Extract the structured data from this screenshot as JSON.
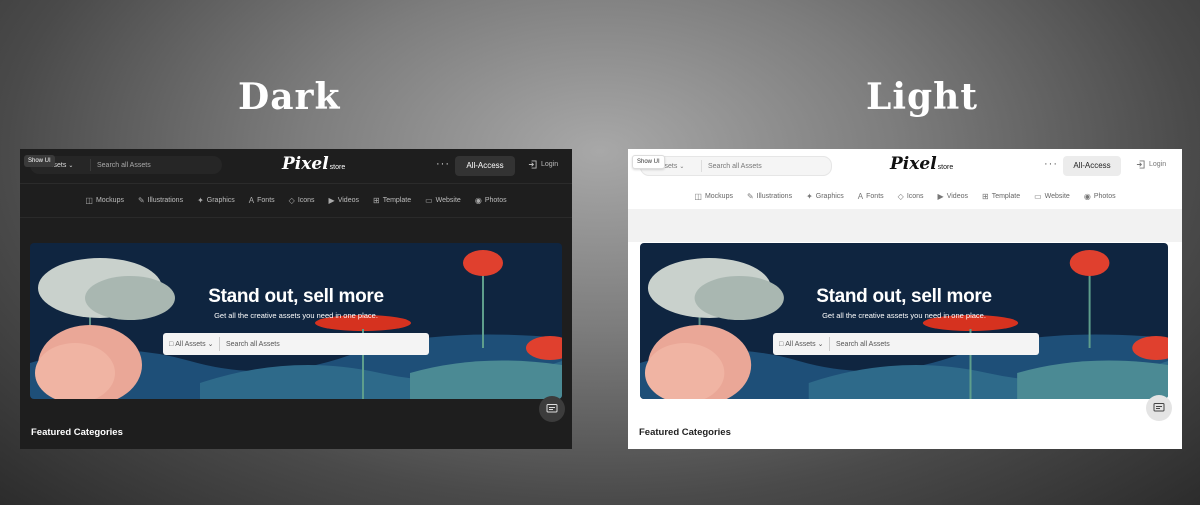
{
  "headings": {
    "dark": "Dark",
    "light": "Light"
  },
  "app": {
    "show_ui": "Show UI",
    "search_category": "All Assets",
    "search_placeholder": "Search all Assets",
    "logo_main": "Pixel",
    "logo_sub": "store",
    "more": "···",
    "all_access": "All-Access",
    "login": "Login",
    "categories": [
      {
        "label": "Mockups",
        "icon": "database-icon"
      },
      {
        "label": "Illustrations",
        "icon": "pen-icon"
      },
      {
        "label": "Graphics",
        "icon": "graphics-icon"
      },
      {
        "label": "Fonts",
        "icon": "font-icon"
      },
      {
        "label": "Icons",
        "icon": "gem-icon"
      },
      {
        "label": "Videos",
        "icon": "video-icon"
      },
      {
        "label": "Template",
        "icon": "grid-icon"
      },
      {
        "label": "Website",
        "icon": "laptop-icon"
      },
      {
        "label": "Photos",
        "icon": "camera-icon"
      }
    ],
    "hero": {
      "title": "Stand out, sell more",
      "subtitle": "Get all the creative assets you need in one place.",
      "search_category": "All Assets",
      "search_placeholder": "Search all Assets"
    },
    "featured": "Featured Categories"
  },
  "colors": {
    "dark_bg": "#1e1e1e",
    "light_bg": "#ffffff",
    "hero_bg": "#0f2540",
    "accent_red": "#e0402e"
  }
}
